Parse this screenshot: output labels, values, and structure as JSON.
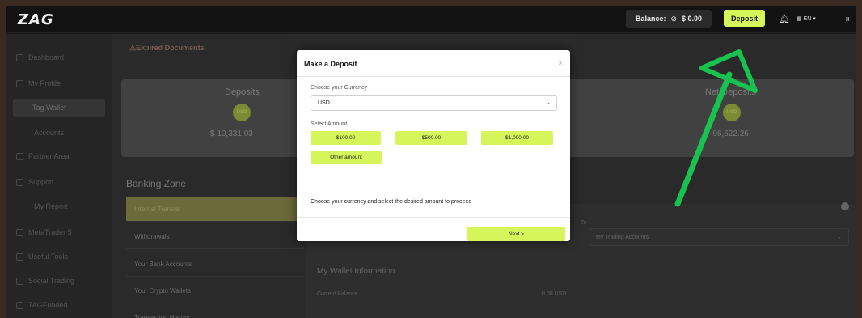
{
  "topbar": {
    "logo": "ZAG",
    "balance_label": "Balance:",
    "balance_value": "$ 0.00",
    "deposit_label": "Deposit",
    "language": "EN"
  },
  "sidebar": {
    "items": [
      {
        "label": "Dashboard"
      },
      {
        "label": "My Profile"
      },
      {
        "label": "Tag Wallet"
      },
      {
        "label": "Accounts"
      },
      {
        "label": "Partner Area"
      },
      {
        "label": "Support"
      },
      {
        "label": "My Report"
      },
      {
        "label": "MetaTrader 5"
      },
      {
        "label": "Useful Tools"
      },
      {
        "label": "Social Trading"
      },
      {
        "label": "TAGFunded"
      }
    ]
  },
  "main": {
    "expired_documents": "Expired Documents",
    "stats": [
      {
        "title": "Deposits",
        "coin": "USD",
        "value": "$ 10,331.03"
      },
      {
        "title": "Net Deposits",
        "coin": "USD",
        "value": "-96,622.26"
      }
    ],
    "banking_zone_title": "Banking Zone",
    "banking_items": [
      {
        "label": "Internal Transfer"
      },
      {
        "label": "Withdrawals"
      },
      {
        "label": "Your Bank Accounts"
      },
      {
        "label": "Your Crypto Wallets"
      },
      {
        "label": "Transaction History"
      }
    ],
    "to_label": "To",
    "to_value": "My Trading Accounts",
    "wallet_info_title": "My Wallet Information",
    "current_balance_label": "Current Balance",
    "current_balance_value": "0.00 USD"
  },
  "modal": {
    "title": "Make a Deposit",
    "close": "×",
    "currency_label": "Choose your Currency",
    "currency_value": "USD",
    "amount_label": "Select Amount",
    "amounts": [
      "$100.00",
      "$500.00",
      "$1,000.00"
    ],
    "other_amount": "Other amount",
    "hint": "Choose your currency and select the desired amount to proceed",
    "next_label": "Next >"
  },
  "colors": {
    "accent": "#d6f55b",
    "arrow": "#18c24f"
  }
}
